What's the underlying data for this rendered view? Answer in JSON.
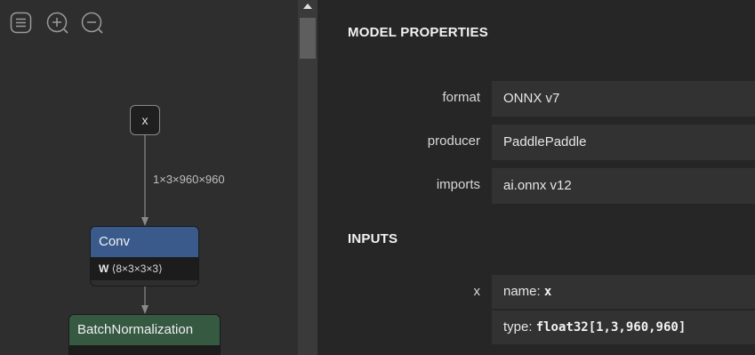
{
  "toolbar": {
    "menu_icon": "menu-icon",
    "zoom_in_icon": "zoom-in-icon",
    "zoom_out_icon": "zoom-out-icon"
  },
  "graph": {
    "input_node": {
      "label": "x"
    },
    "edge_label": "1×3×960×960",
    "conv_node": {
      "title": "Conv",
      "attr_name": "W",
      "attr_value": "⟨8×3×3×3⟩",
      "color": "#3b5a8c"
    },
    "bn_node": {
      "title": "BatchNormalization",
      "color": "#365942"
    }
  },
  "properties": {
    "model_title": "MODEL PROPERTIES",
    "rows": [
      {
        "label": "format",
        "value": "ONNX v7"
      },
      {
        "label": "producer",
        "value": "PaddlePaddle"
      },
      {
        "label": "imports",
        "value": "ai.onnx v12"
      }
    ],
    "inputs_title": "INPUTS",
    "input": {
      "label": "x",
      "name_prefix": "name: ",
      "name_value": "x",
      "type_prefix": "type: ",
      "type_value": "float32[1,3,960,960]"
    }
  }
}
